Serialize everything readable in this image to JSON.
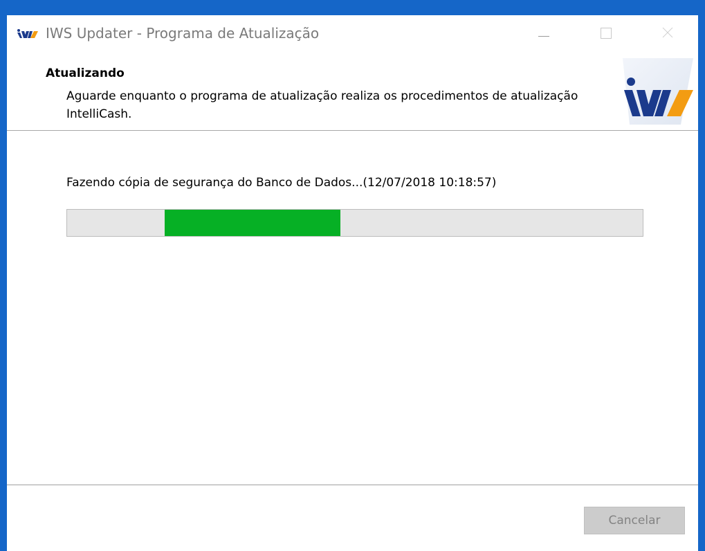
{
  "window": {
    "title": "IWS Updater - Programa de Atualização",
    "icon": "iws-logo-icon",
    "controls": [
      "minimize-icon",
      "maximize-icon",
      "close-icon"
    ]
  },
  "header": {
    "title": "Atualizando",
    "description": "Aguarde enquanto o programa de atualização realiza os procedimentos de atualização IntelliCash.",
    "logo": "iws-logo"
  },
  "progress": {
    "status": "Fazendo cópia de segurança do Banco de Dados...(12/07/2018 10:18:57)",
    "segment_start": 0.17,
    "segment_end": 0.475,
    "color": "#06b025"
  },
  "footer": {
    "cancel_label": "Cancelar"
  },
  "colors": {
    "frame": "#1566c8",
    "logo_blue": "#1b3a8c",
    "logo_orange": "#f39c12"
  }
}
